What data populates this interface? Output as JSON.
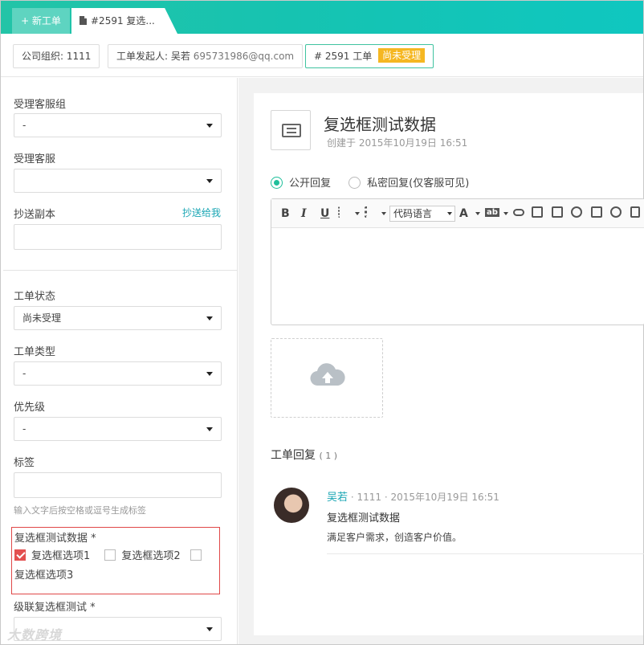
{
  "tabs": {
    "new_tab_label": "+ 新工单",
    "active_tab_label": "#2591 复选..."
  },
  "info": {
    "org_label": "公司组织:",
    "org_value": "1111",
    "initiator_label": "工单发起人:",
    "initiator_name": "吴若",
    "initiator_email": "695731986@qq.com",
    "ticket_id": "# 2591 工单",
    "status_badge": "尚未受理",
    "status_badge_color": "#f5b722"
  },
  "sidebar": {
    "group_label": "受理客服组",
    "group_value": "-",
    "agent_label": "受理客服",
    "agent_value": "",
    "cc_label": "抄送副本",
    "cc_link": "抄送给我",
    "status_label": "工单状态",
    "status_value": "尚未受理",
    "type_label": "工单类型",
    "type_value": "-",
    "priority_label": "优先级",
    "priority_value": "-",
    "tags_label": "标签",
    "tags_hint": "输入文字后按空格或逗号生成标签",
    "checkbox_field_label": "复选框测试数据 *",
    "checkbox_options": [
      {
        "label": "复选框选项1",
        "checked": true
      },
      {
        "label": "复选框选项2",
        "checked": false
      },
      {
        "label": "复选框选项3",
        "checked": false
      }
    ],
    "cascade_label": "级联复选框测试 *",
    "cascade_value": ""
  },
  "main": {
    "title": "复选框测试数据",
    "created": "创建于 2015年10月19日 16:51",
    "reply_public": "公开回复",
    "reply_private": "私密回复(仅客服可见)",
    "toolbar": {
      "bold": "B",
      "italic": "I",
      "underline": "U",
      "code_lang": "代码语言",
      "font_color": "A",
      "highlight": "ab"
    },
    "replies_title": "工单回复",
    "replies_count": "( 1 )",
    "reply": {
      "author": "吴若",
      "meta": "· 1111 · 2015年10月19日 16:51",
      "title": "复选框测试数据",
      "body": "满足客户需求，创造客户价值。"
    }
  },
  "watermark": "大数跨境",
  "colors": {
    "accent": "#1fbf9b",
    "link": "#1aa6b4",
    "error_border": "#e04848",
    "checkbox_checked": "#e35050"
  }
}
